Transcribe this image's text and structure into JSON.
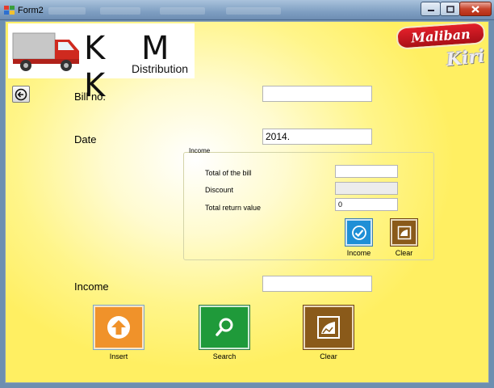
{
  "window": {
    "title": "Form2"
  },
  "colors": {
    "orange": "#f0922a",
    "green": "#1f9a3a",
    "brown": "#8a5a1a",
    "blue": "#1f8fd6",
    "yellow": "#fff58a"
  },
  "header": {
    "logo_text": "K M K",
    "logo_subtitle": "Distribution",
    "brand": "Maliban",
    "brand_sub": "Kiri"
  },
  "form": {
    "bill_label": "Bill no.",
    "bill_value": "",
    "date_label": "Date",
    "date_value": "2014.",
    "income_label": "Income",
    "income_value": ""
  },
  "income_group": {
    "title": "Income",
    "total_label": "Total of the bill",
    "total_value": "",
    "discount_label": "Discount",
    "discount_value": "",
    "return_label": "Total return value",
    "return_value": "0",
    "income_button": "Income",
    "clear_button": "Clear"
  },
  "actions": {
    "insert": "Insert",
    "search": "Search",
    "clear": "Clear"
  },
  "icons": {
    "back": "arrow-left-circle-icon",
    "insert": "arrow-up-circle-icon",
    "search": "magnifier-icon",
    "clear": "eraser-icon",
    "income": "checkmark-icon"
  }
}
